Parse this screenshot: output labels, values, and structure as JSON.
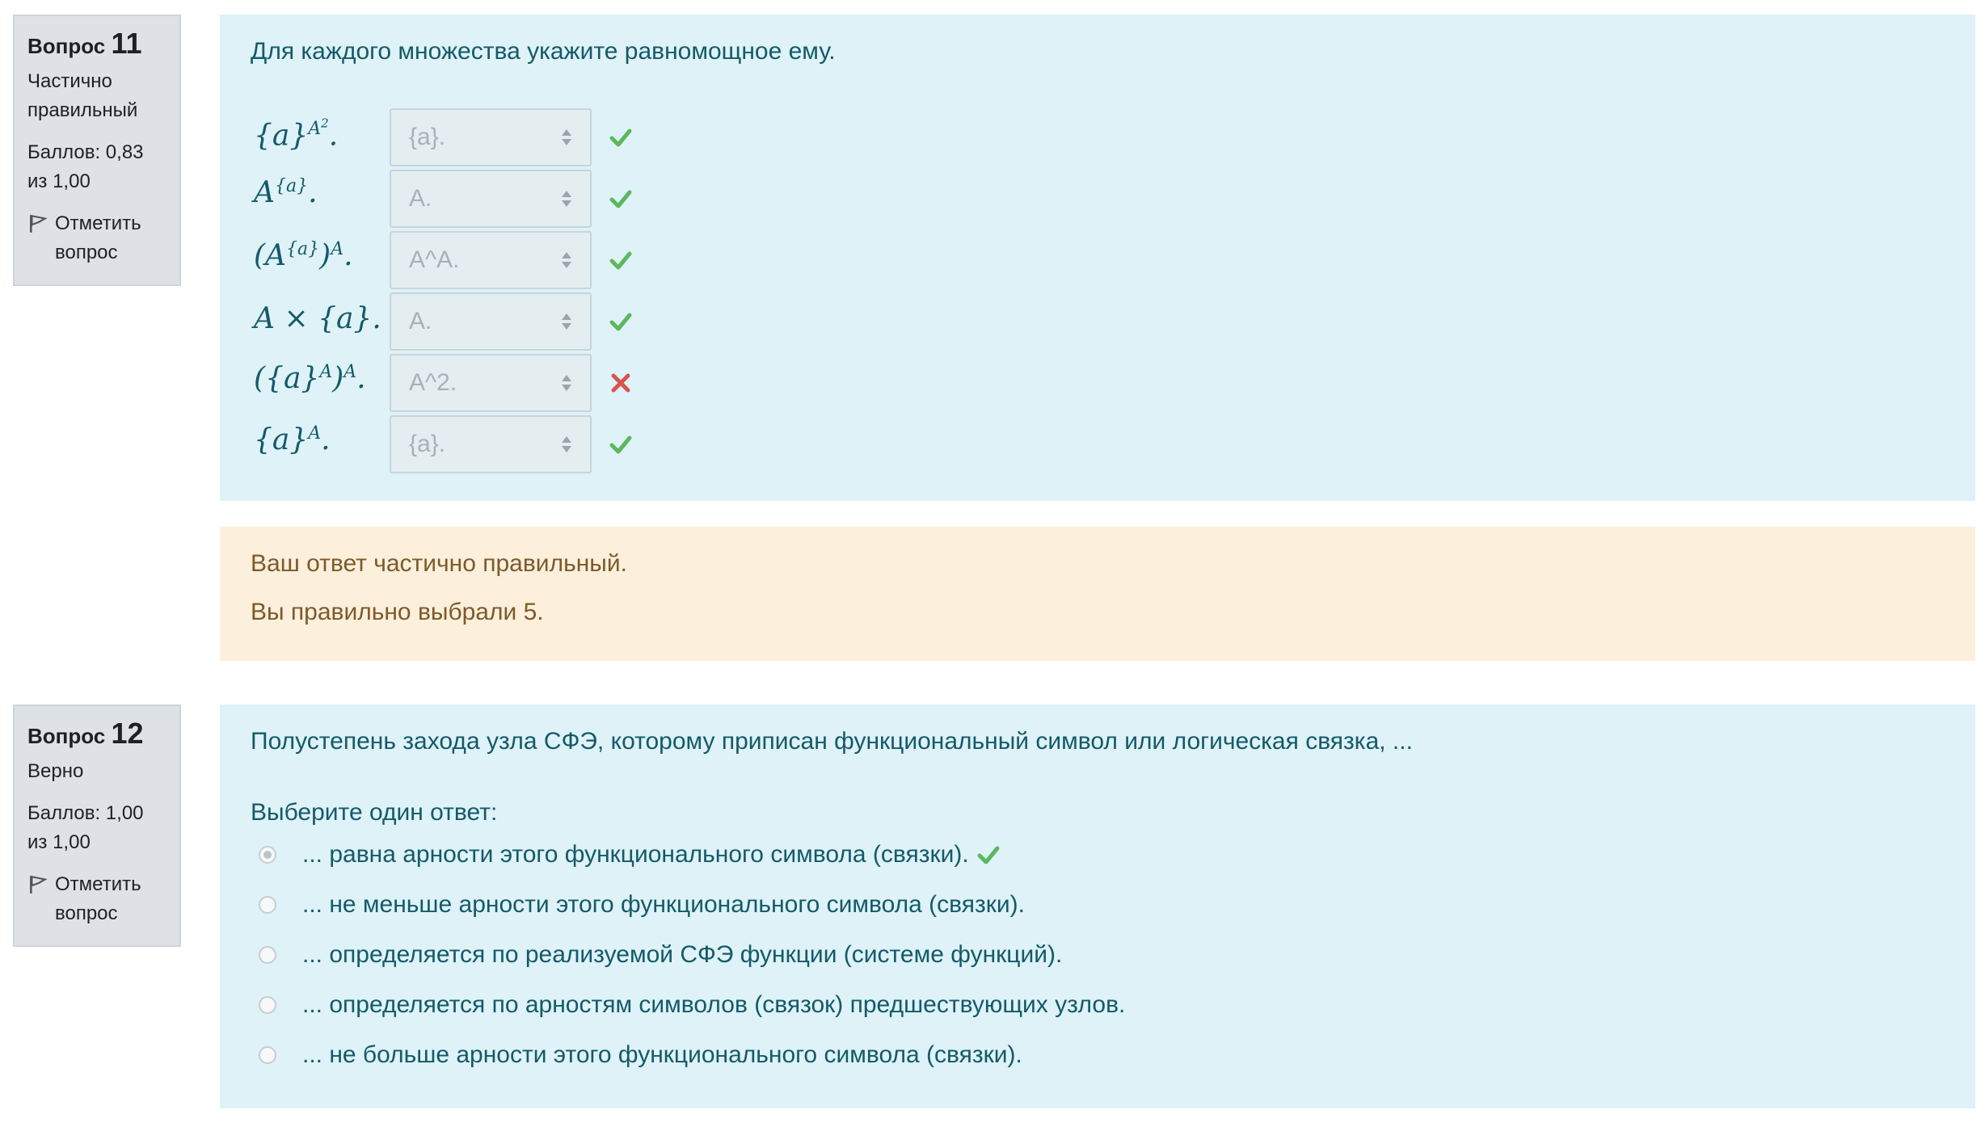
{
  "q11": {
    "info": {
      "label": "Вопрос",
      "number": "11",
      "state": "Частично правильный",
      "grade": "Баллов: 0,83 из 1,00",
      "flag": "Отметить вопрос"
    },
    "text": "Для каждого множества укажите равномощное ему.",
    "rows": [
      {
        "answer": "{a}.",
        "correct": true
      },
      {
        "answer": "A.",
        "correct": true
      },
      {
        "answer": "A^A.",
        "correct": true
      },
      {
        "answer": "A.",
        "correct": true
      },
      {
        "answer": "A^2.",
        "correct": false
      },
      {
        "answer": "{a}.",
        "correct": true
      }
    ],
    "feedback": {
      "line1": "Ваш ответ частично правильный.",
      "line2": "Вы правильно выбрали 5."
    }
  },
  "q12": {
    "info": {
      "label": "Вопрос",
      "number": "12",
      "state": "Верно",
      "grade": "Баллов: 1,00 из 1,00",
      "flag": "Отметить вопрос"
    },
    "text": "Полустепень захода узла СФЭ, которому приписан функциональный символ или логическая связка, ...",
    "prompt": "Выберите один ответ:",
    "options": [
      {
        "label": "... равна арности этого функционального символа (связки).",
        "selected": true
      },
      {
        "label": "... не меньше арности этого функционального символа (связки).",
        "selected": false
      },
      {
        "label": "... определяется по реализуемой СФЭ функции (системе функций).",
        "selected": false
      },
      {
        "label": "... определяется по арностям символов (связок) предшествующих узлов.",
        "selected": false
      },
      {
        "label": "... не больше арности этого функционального символа (связки).",
        "selected": false
      }
    ]
  },
  "colors": {
    "correct": "#5cb85c",
    "incorrect": "#d9534f",
    "question_bg": "#def2f8",
    "feedback_bg": "#fcefdc",
    "info_bg": "#dee2e6"
  },
  "icons": {
    "flag": "flag-icon",
    "correct": "check-icon",
    "incorrect": "cross-icon",
    "select": "updown-arrows-icon"
  }
}
